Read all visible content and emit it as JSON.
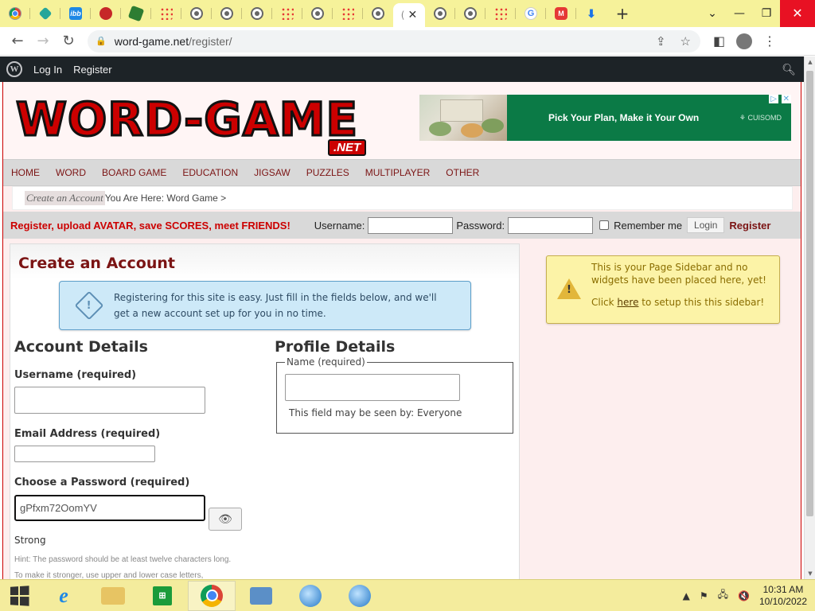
{
  "browser": {
    "url_host": "word-game.net",
    "url_path": "/register/",
    "tab_close": "✕",
    "new_tab": "+"
  },
  "wpbar": {
    "login": "Log In",
    "register": "Register"
  },
  "header": {
    "logo_text": "WORD-GAME",
    "logo_suffix": ".NET",
    "ad_text": "Pick Your Plan, Make it Your Own",
    "ad_brand": "⚘ CUISOMD"
  },
  "nav": [
    "HOME",
    "WORD",
    "BOARD GAME",
    "EDUCATION",
    "JIGSAW",
    "PUZZLES",
    "MULTIPLAYER",
    "OTHER"
  ],
  "breadcrumb": {
    "current": "Create an Account",
    "trail": "You Are Here: Word Game >"
  },
  "loginbar": {
    "promo": "Register, upload AVATAR, save SCORES, meet FRIENDS!",
    "username_label": "Username:",
    "password_label": "Password:",
    "remember_label": "Remember me",
    "login_button": "Login",
    "register_link": "Register"
  },
  "form": {
    "title": "Create an Account",
    "info": "Registering for this site is easy. Just fill in the fields below, and we'll get a new account set up for you in no time.",
    "account_title": "Account Details",
    "username_label": "Username (required)",
    "email_label": "Email Address (required)",
    "password_label": "Choose a Password (required)",
    "password_value": "gPfxm72OomYV",
    "strength": "Strong",
    "hint1": "Hint: The password should be at least twelve characters long.",
    "hint2": "To make it stronger, use upper and lower case letters,",
    "profile_title": "Profile Details",
    "name_legend": "Name (required)",
    "visibility": "This field may be seen by: Everyone"
  },
  "sidebar": {
    "note": "This is your Page Sidebar and no widgets have been placed here, yet!",
    "link_prefix": "Click ",
    "link_word": "here",
    "link_suffix": " to setup this this sidebar!"
  },
  "taskbar": {
    "time": "10:31 AM",
    "date": "10/10/2022"
  },
  "colors": {
    "brand_red": "#c00000",
    "nav_text": "#7b1414",
    "tabbar": "#f6f29a"
  }
}
